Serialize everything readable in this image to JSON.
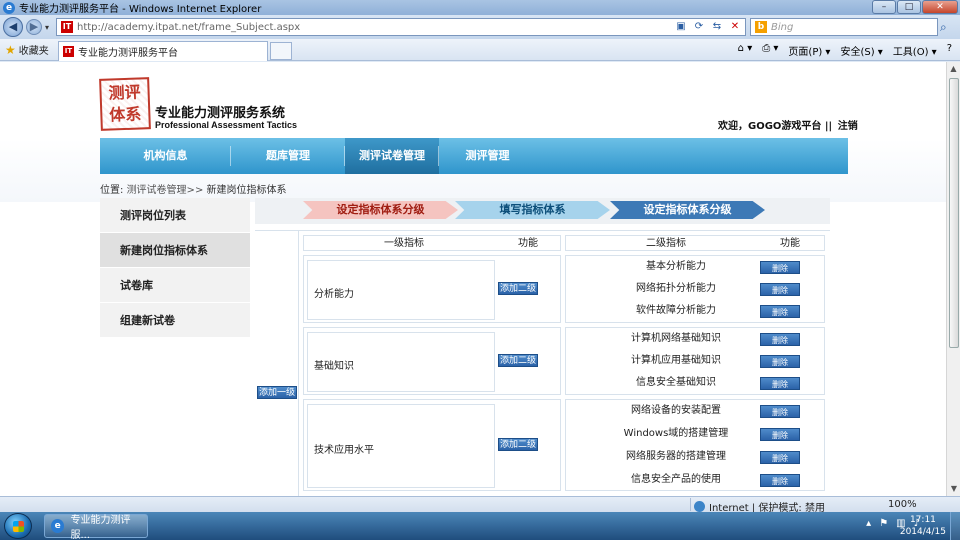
{
  "browser": {
    "window_title": "专业能力测评服务平台 - Windows Internet Explorer",
    "url": "http://academy.itpat.net/frame_Subject.aspx",
    "search_placeholder": "Bing",
    "favorites_label": "收藏夹",
    "tab_title": "专业能力测评服务平台",
    "cmd_page": "页面(P) ▾",
    "cmd_safety": "安全(S) ▾",
    "cmd_tools": "工具(O) ▾",
    "cmd_help": "?"
  },
  "site": {
    "seal_text": "测评\n体系",
    "brand_cn": "专业能力测评服务系统",
    "brand_en": "Professional Assessment Tactics",
    "welcome": "欢迎，GOGO游戏平台",
    "sep": "||",
    "logout": "注销"
  },
  "nav": {
    "items": [
      "机构信息",
      "题库管理",
      "测评试卷管理",
      "测评管理"
    ]
  },
  "breadcrumb": {
    "prefix": "位置:",
    "link": "测评试卷管理>>",
    "current": "新建岗位指标体系"
  },
  "sidebar": {
    "items": [
      "测评岗位列表",
      "新建岗位指标体系",
      "试卷库",
      "组建新试卷"
    ]
  },
  "steps": [
    "设定指标体系分级",
    "填写指标体系",
    "设定指标体系分级"
  ],
  "table": {
    "l1_header": "一级指标",
    "func_header": "功能",
    "l2_header": "二级指标",
    "func_header2": "功能",
    "add_l1_label": "添加一级",
    "add_l2_label": "添加二级",
    "del_label": "删除",
    "groups": [
      {
        "name": "分析能力",
        "children": [
          "基本分析能力",
          "网络拓扑分析能力",
          "软件故障分析能力"
        ]
      },
      {
        "name": "基础知识",
        "children": [
          "计算机网络基础知识",
          "计算机应用基础知识",
          "信息安全基础知识"
        ]
      },
      {
        "name": "技术应用水平",
        "children": [
          "网络设备的安装配置",
          "Windows域的搭建管理",
          "网络服务器的搭建管理",
          "信息安全产品的使用"
        ]
      }
    ]
  },
  "status": {
    "zone": "Internet | 保护模式: 禁用",
    "zoom": "100%"
  },
  "taskbar": {
    "task_label": "专业能力测评服...",
    "time": "17:11",
    "date": "2014/4/15"
  }
}
